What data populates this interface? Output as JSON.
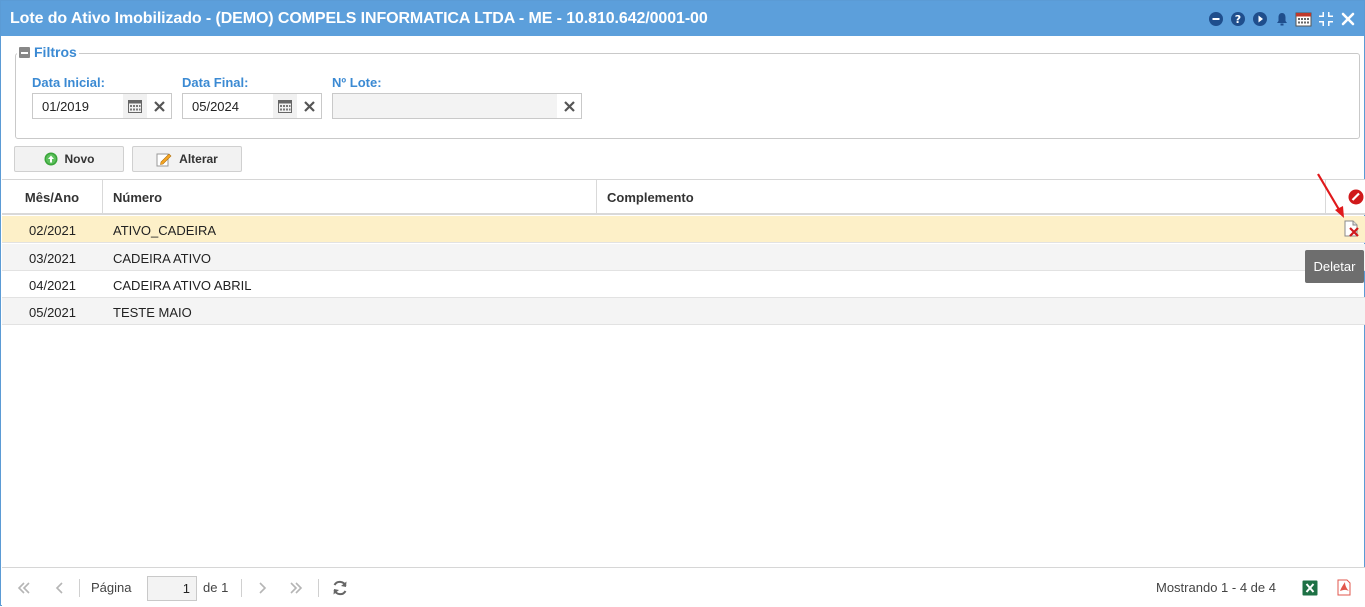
{
  "window": {
    "title": "Lote do Ativo Imobilizado - (DEMO) COMPELS INFORMATICA LTDA - ME - 10.810.642/0001-00",
    "header_icons": [
      "minimize-circle-icon",
      "help-icon",
      "play-icon",
      "bell-icon",
      "calendar-icon",
      "compress-icon",
      "close-icon"
    ]
  },
  "filters": {
    "legend": "Filtros",
    "data_inicial": {
      "label": "Data Inicial:",
      "value": "01/2019"
    },
    "data_final": {
      "label": "Data Final:",
      "value": "05/2024"
    },
    "lote": {
      "label": "Nº Lote:",
      "value": ""
    }
  },
  "toolbar": {
    "novo_label": "Novo",
    "alterar_label": "Alterar"
  },
  "grid": {
    "columns": [
      "Mês/Ano",
      "Número",
      "Complemento"
    ],
    "rows": [
      {
        "mes_ano": "02/2021",
        "numero": "ATIVO_CADEIRA",
        "complemento": ""
      },
      {
        "mes_ano": "03/2021",
        "numero": "CADEIRA ATIVO",
        "complemento": ""
      },
      {
        "mes_ano": "04/2021",
        "numero": "CADEIRA ATIVO ABRIL",
        "complemento": ""
      },
      {
        "mes_ano": "05/2021",
        "numero": "TESTE MAIO",
        "complemento": ""
      }
    ],
    "selected_row": 0,
    "tooltip": "Deletar"
  },
  "pager": {
    "page_label": "Página",
    "page_value": "1",
    "of_label": "de 1",
    "status": "Mostrando 1 - 4 de 4"
  },
  "colors": {
    "titlebar": "#5c9fdb",
    "label_blue": "#3b8ad3",
    "selected_row": "#fdf0c8",
    "excel_green": "#1e7145",
    "pdf_red": "#e2574c"
  }
}
